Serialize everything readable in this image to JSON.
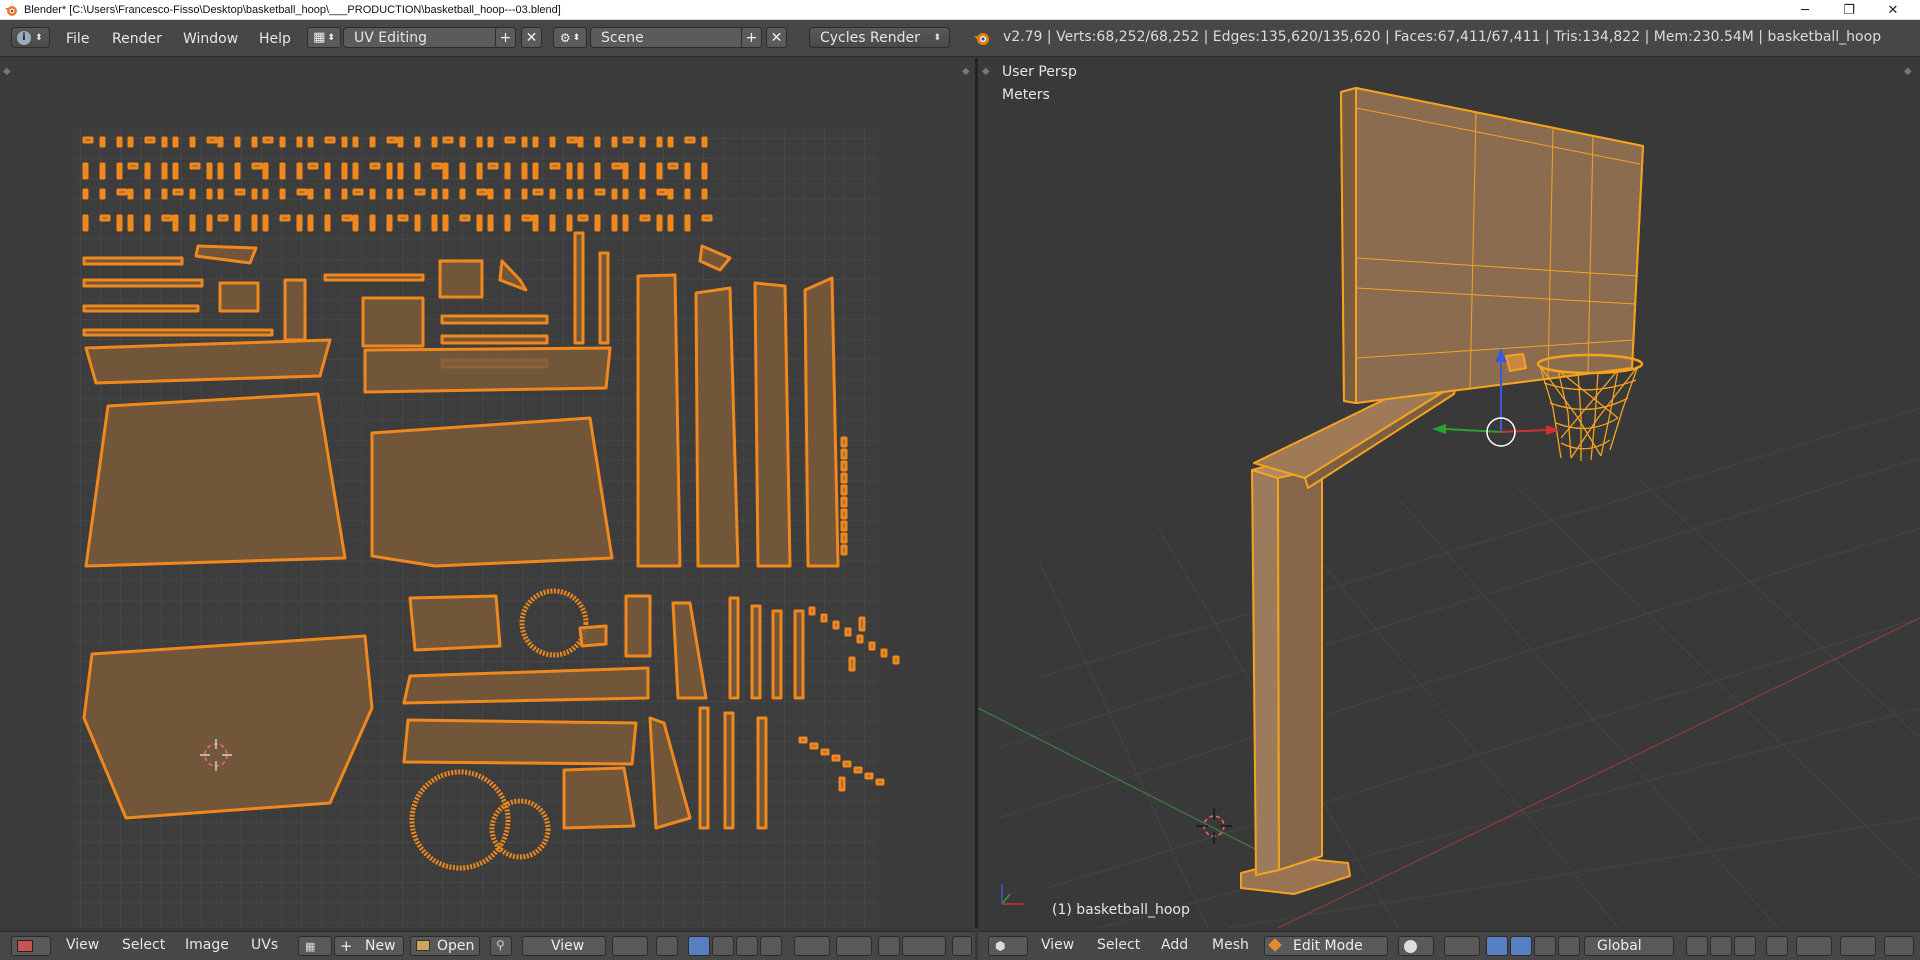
{
  "window": {
    "title": "Blender* [C:\\Users\\Francesco-Fisso\\Desktop\\basketball_hoop\\___PRODUCTION\\basketball_hoop---03.blend]",
    "minimize_icon": "minimize-icon",
    "maximize_icon": "restore-icon",
    "close_icon": "close-icon"
  },
  "info_header": {
    "menus": [
      "File",
      "Render",
      "Window",
      "Help"
    ],
    "screen_layout": "UV Editing",
    "scene": "Scene",
    "render_engine": "Cycles Render",
    "stats": "v2.79 | Verts:68,252/68,252 | Edges:135,620/135,620 | Faces:67,411/67,411 | Tris:134,822 | Mem:230.54M | basketball_hoop"
  },
  "viewport": {
    "view_name": "User Persp",
    "units": "Meters",
    "object_label": "(1) basketball_hoop"
  },
  "uv_header": {
    "menus": [
      "View",
      "Select",
      "Image",
      "UVs"
    ],
    "new_label": "New",
    "open_label": "Open",
    "view_label": "View"
  },
  "view3d_header": {
    "menus": [
      "View",
      "Select",
      "Add",
      "Mesh"
    ],
    "mode": "Edit Mode",
    "orientation": "Global"
  },
  "colors": {
    "accent_orange": "#f0881e",
    "uv_fill": "#7a5a3a",
    "header_bg": "#474747",
    "viewport_bg": "#393939"
  }
}
